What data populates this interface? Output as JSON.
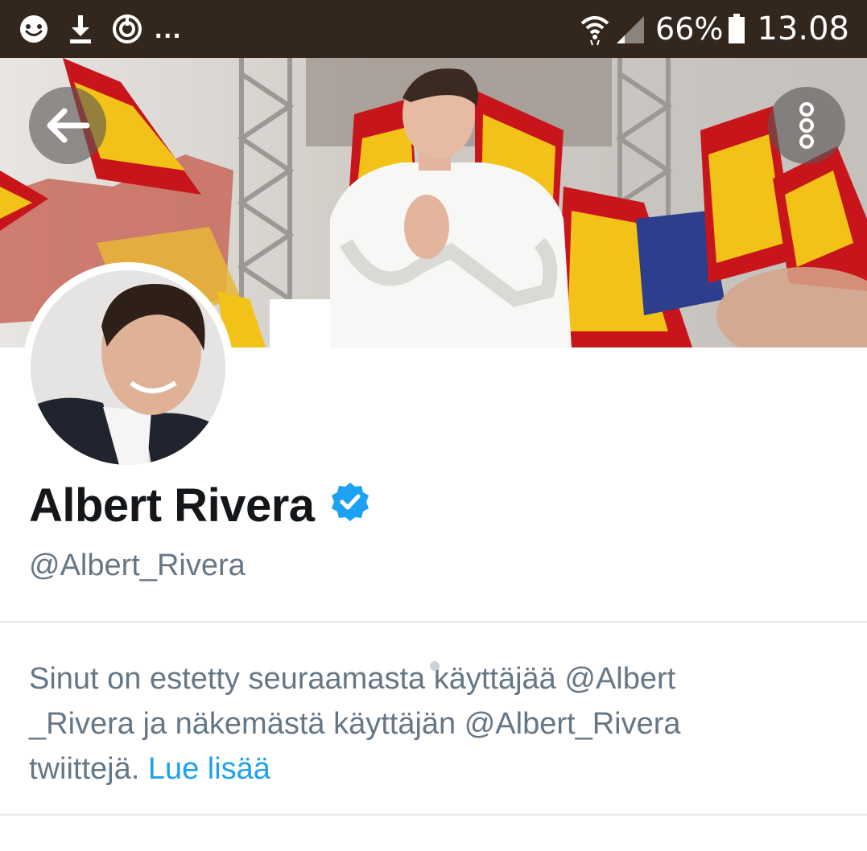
{
  "status_bar": {
    "notification_icons": [
      "smiley-icon",
      "download-icon",
      "sync-icon"
    ],
    "more_indicator": "...",
    "battery_percent": "66%",
    "time": "13.08",
    "status_icons": [
      "wifi-icon",
      "signal-icon",
      "battery-icon"
    ]
  },
  "header": {
    "back_icon": "arrow-left-icon",
    "menu_icon": "more-vertical-icon"
  },
  "profile": {
    "display_name": "Albert Rivera",
    "handle": "@Albert_Rivera",
    "verified": true,
    "verified_color": "#1da1f2"
  },
  "blocked_notice": {
    "line1": "Sinut on estetty seuraamasta käyttäjää @Albert",
    "line2": "_Rivera ja näkemästä käyttäjän @Albert_Rivera",
    "line3_prefix": "twiittejä. ",
    "learn_more": "Lue lisää"
  },
  "colors": {
    "status_bar": "#33261d",
    "text_primary": "#14171a",
    "text_secondary": "#657786",
    "link": "#1da1f2",
    "divider": "#e1e8ed"
  }
}
